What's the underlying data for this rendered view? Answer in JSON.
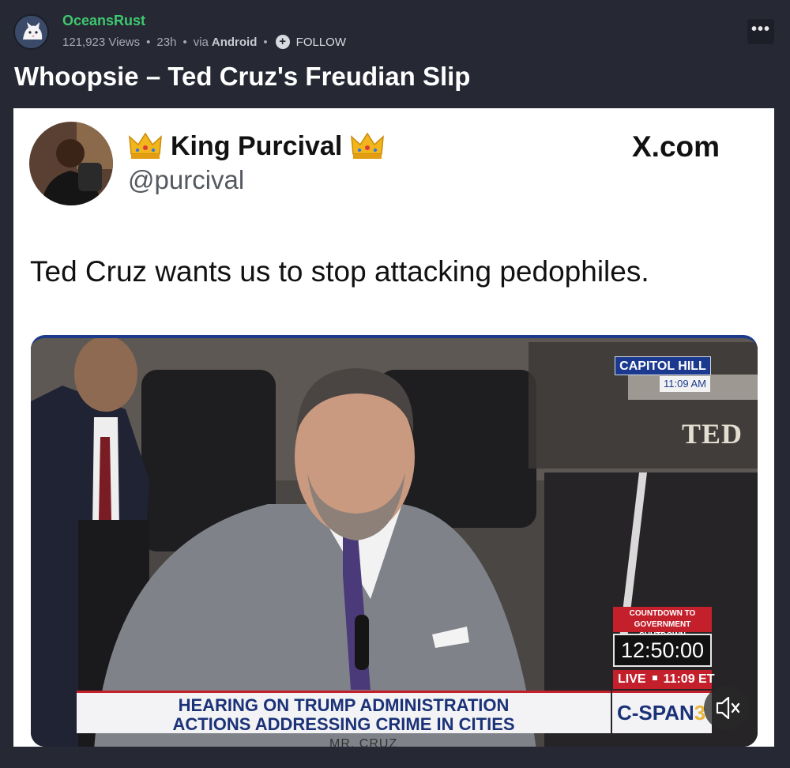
{
  "post": {
    "username": "OceansRust",
    "views": "121,923 Views",
    "age": "23h",
    "via_prefix": "via",
    "via_platform": "Android",
    "follow_label": "FOLLOW",
    "more_label": "•••",
    "title": "Whoopsie – Ted Cruz's Freudian Slip"
  },
  "tweet": {
    "display_name": "King Purcival",
    "handle": "@purcival",
    "source": "X.com",
    "text": "Ted Cruz wants us to stop attacking pedophiles."
  },
  "video": {
    "capitol_label": "CAPITOL HILL",
    "capitol_time": "11:09 AM",
    "nameplate": "TED",
    "countdown_label_1": "COUNTDOWN TO",
    "countdown_label_2": "GOVERNMENT SHUTDOWN",
    "countdown_time": "12:50:00",
    "live_label": "LIVE",
    "live_time": "11:09 ET",
    "chyron_line_1": "HEARING ON TRUMP ADMINISTRATION",
    "chyron_line_2": "ACTIONS ADDRESSING CRIME IN CITIES",
    "network": "C-SPAN",
    "network_number": "3",
    "speaker_plate": "MR. CRUZ"
  },
  "icons": {
    "avatar": "cat-avatar-icon",
    "follow": "plus-circle-icon",
    "more": "more-options-icon",
    "crown": "crown-icon",
    "mute": "speaker-muted-icon"
  },
  "colors": {
    "background": "#262834",
    "username": "#3ec86f",
    "cspan_blue": "#1b3278",
    "alert_red": "#c4202c"
  }
}
